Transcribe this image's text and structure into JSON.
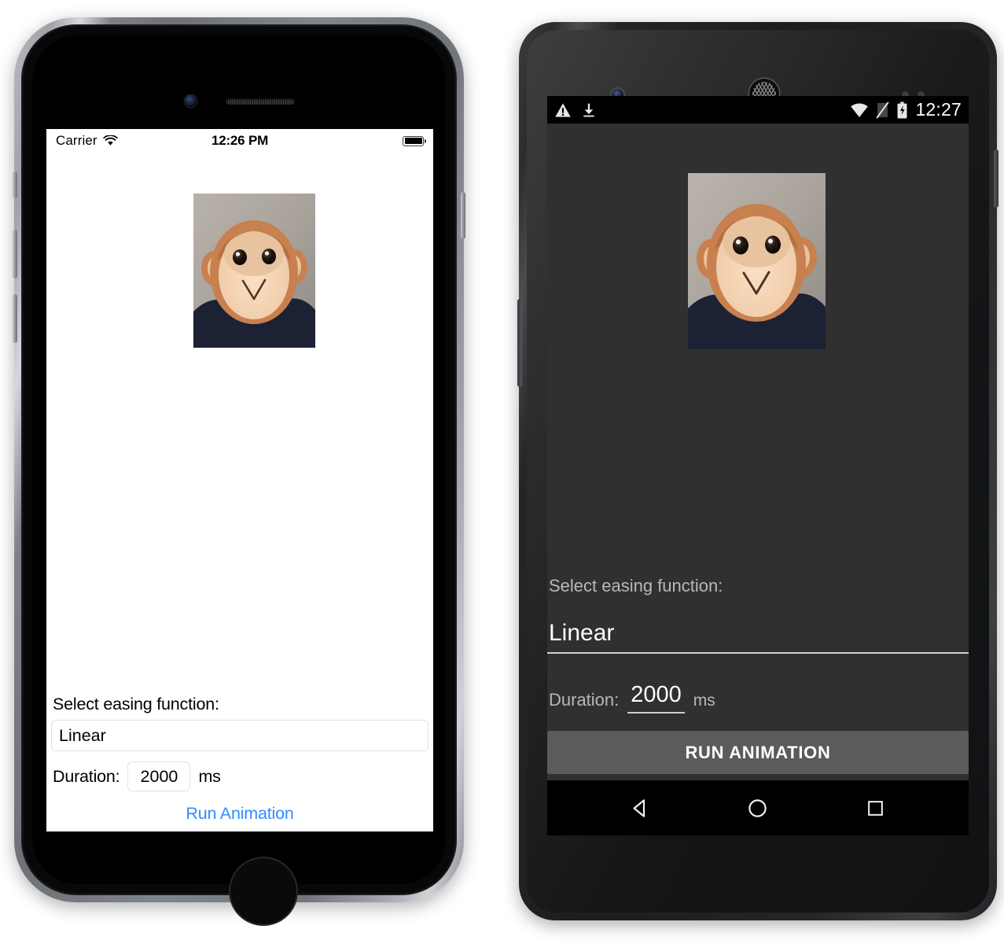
{
  "app": {
    "screen_title": "Easing animation demo",
    "image_subject": "plush monkey toy photo"
  },
  "ios": {
    "status_bar": {
      "carrier": "Carrier",
      "wifi_icon": "wifi-icon",
      "time": "12:26 PM",
      "battery_icon": "battery-full-icon"
    },
    "image_name": "monkey-photo",
    "easing_label": "Select easing function:",
    "easing_value": "Linear",
    "easing_placeholder": "Linear",
    "duration_label": "Duration:",
    "duration_value": "2000",
    "duration_placeholder": "2000",
    "duration_unit": "ms",
    "run_button": "Run Animation",
    "accent_color": "#2f8cff",
    "background_color": "#ffffff",
    "home_button": "home-button"
  },
  "android": {
    "status_bar": {
      "warning_icon": "warning-triangle-icon",
      "download_icon": "download-icon",
      "wifi_icon": "wifi-icon",
      "sim_icon": "no-sim-icon",
      "battery_icon": "battery-charging-icon",
      "time": "12:27"
    },
    "image_name": "monkey-photo",
    "easing_label": "Select easing function:",
    "easing_value": "Linear",
    "easing_placeholder": "Linear",
    "duration_label": "Duration:",
    "duration_value": "2000",
    "duration_placeholder": "2000",
    "duration_unit": "ms",
    "run_button": "RUN ANIMATION",
    "background_color": "#303030",
    "button_color": "#5b5b5b",
    "nav_bar": {
      "back": "back-button",
      "home": "home-button",
      "recents": "recents-button"
    }
  }
}
